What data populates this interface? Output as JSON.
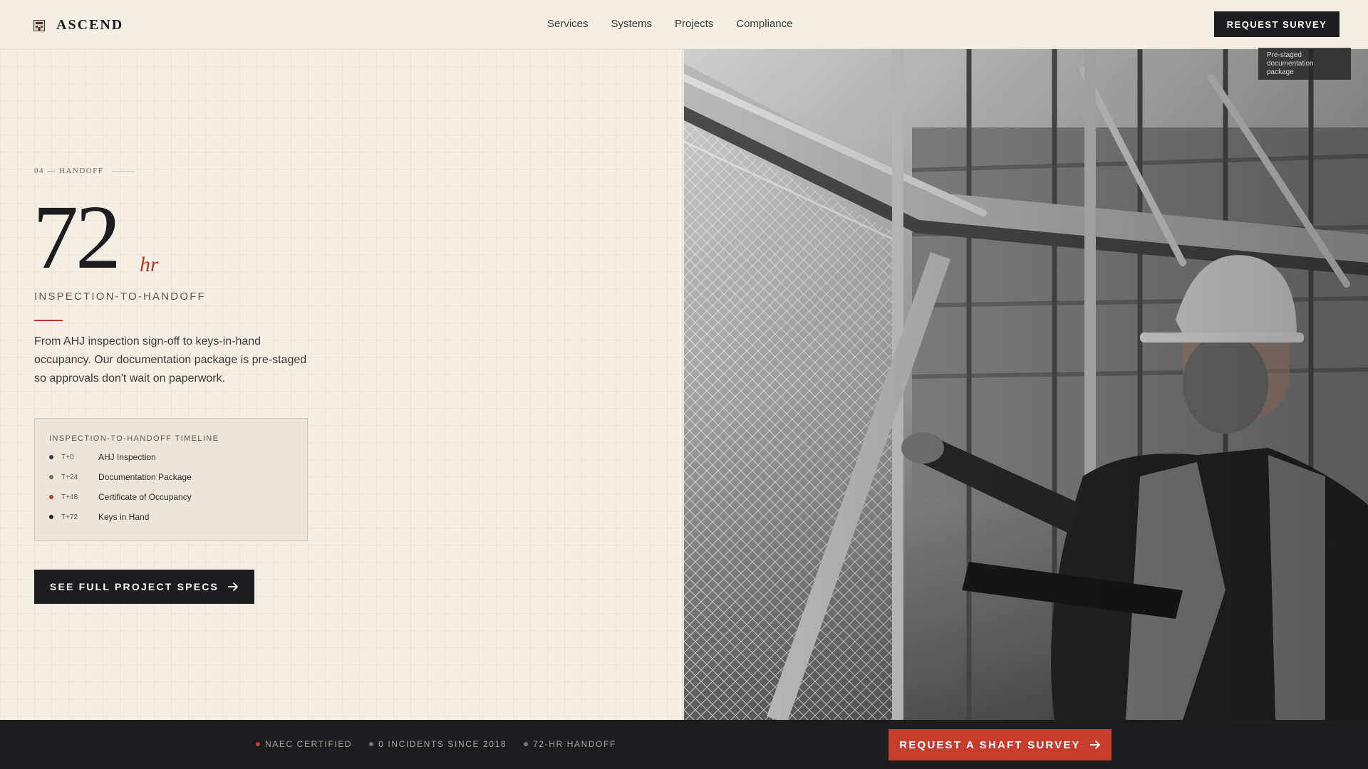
{
  "brand": {
    "name": "ASCEND",
    "logo_icon": "building-icon"
  },
  "nav": {
    "items": [
      {
        "label": "Services"
      },
      {
        "label": "Systems"
      },
      {
        "label": "Projects"
      },
      {
        "label": "Compliance"
      }
    ]
  },
  "header": {
    "cta_label": "REQUEST SURVEY"
  },
  "hero": {
    "eyebrow": "04 — HANDOFF",
    "stat_value": "72",
    "stat_unit": "hr",
    "stat_label": "INSPECTION-TO-HANDOFF",
    "body": "From AHJ inspection sign-off to keys-in-hand occupancy. Our documentation package is pre-staged so approvals don't wait on paperwork.",
    "timeline": {
      "title": "INSPECTION-TO-HANDOFF TIMELINE",
      "rows": [
        {
          "time": "T+0",
          "label": "AHJ Inspection"
        },
        {
          "time": "T+24",
          "label": "Documentation Package"
        },
        {
          "time": "T+48",
          "label": "Certificate of Occupancy"
        },
        {
          "time": "T+72",
          "label": "Keys in Hand"
        }
      ]
    },
    "specs_button_label": "SEE FULL PROJECT SPECS"
  },
  "photo": {
    "badge_text": "Pre-staged documentation package"
  },
  "footer": {
    "trust": [
      {
        "label": "NAEC CERTIFIED"
      },
      {
        "label": "0 INCIDENTS SINCE 2018"
      },
      {
        "label": "72-HR HANDOFF"
      }
    ],
    "cta_label": "REQUEST A SHAFT SURVEY"
  },
  "colors": {
    "background": "#f4efe6",
    "ink": "#1d1d1f",
    "accent": "#b83a2c",
    "cta_red": "#c63d2d"
  }
}
